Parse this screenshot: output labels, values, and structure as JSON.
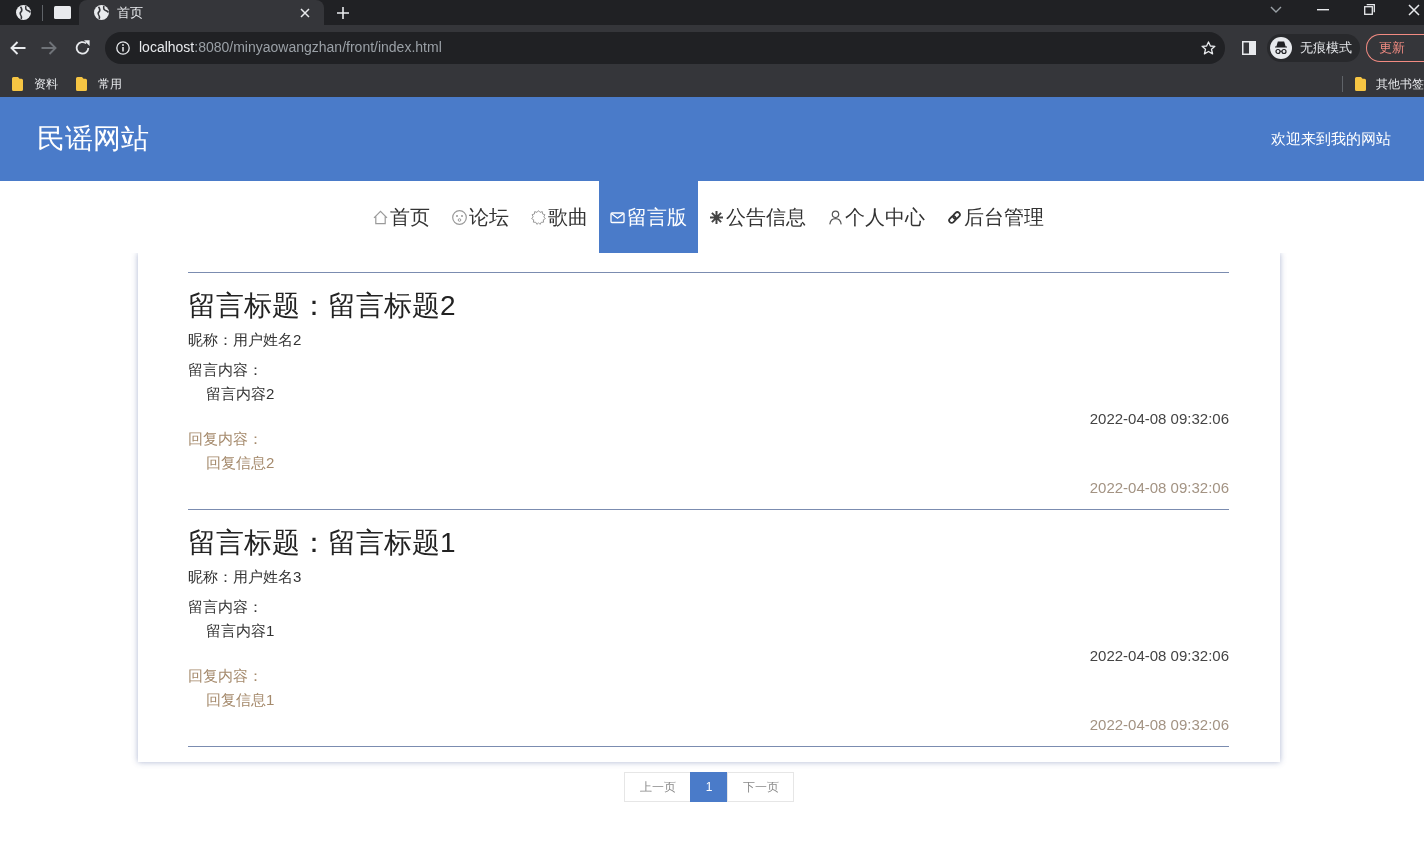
{
  "browser": {
    "tabs": [
      {
        "title": "首页",
        "selected": true
      }
    ],
    "back": {
      "disabled": false
    },
    "forward": {
      "disabled": true
    },
    "url_host": "localhost",
    "url_path": ":8080/minyaowangzhan/front/index.html",
    "profile": "无痕模式",
    "update_button": "更新",
    "bookmarks": [
      "资料",
      "常用"
    ],
    "other_bookmarks": "其他书签"
  },
  "header": {
    "site_title": "民谣网站",
    "welcome": "欢迎来到我的网站"
  },
  "nav": [
    {
      "label": "首页",
      "selected": false
    },
    {
      "label": "论坛",
      "selected": false
    },
    {
      "label": "歌曲",
      "selected": false
    },
    {
      "label": "留言版",
      "selected": true
    },
    {
      "label": "公告信息",
      "selected": false
    },
    {
      "label": "个人中心",
      "selected": false
    },
    {
      "label": "后台管理",
      "selected": false
    }
  ],
  "messages": [
    {
      "title": "留言标题：留言标题2",
      "nickname": "昵称：用户姓名2",
      "content_label": "留言内容：",
      "content": "留言内容2",
      "date": "2022-04-08 09:32:06",
      "reply_label": "回复内容：",
      "reply": "回复信息2",
      "reply_date": "2022-04-08 09:32:06"
    },
    {
      "title": "留言标题：留言标题1",
      "nickname": "昵称：用户姓名3",
      "content_label": "留言内容：",
      "content": "留言内容1",
      "date": "2022-04-08 09:32:06",
      "reply_label": "回复内容：",
      "reply": "回复信息1",
      "reply_date": "2022-04-08 09:32:06"
    }
  ],
  "pagination": {
    "prev": {
      "label": "上一页",
      "disabled": true
    },
    "pages": [
      {
        "label": "1",
        "selected": true
      }
    ],
    "next": {
      "label": "下一页",
      "disabled": true
    }
  }
}
